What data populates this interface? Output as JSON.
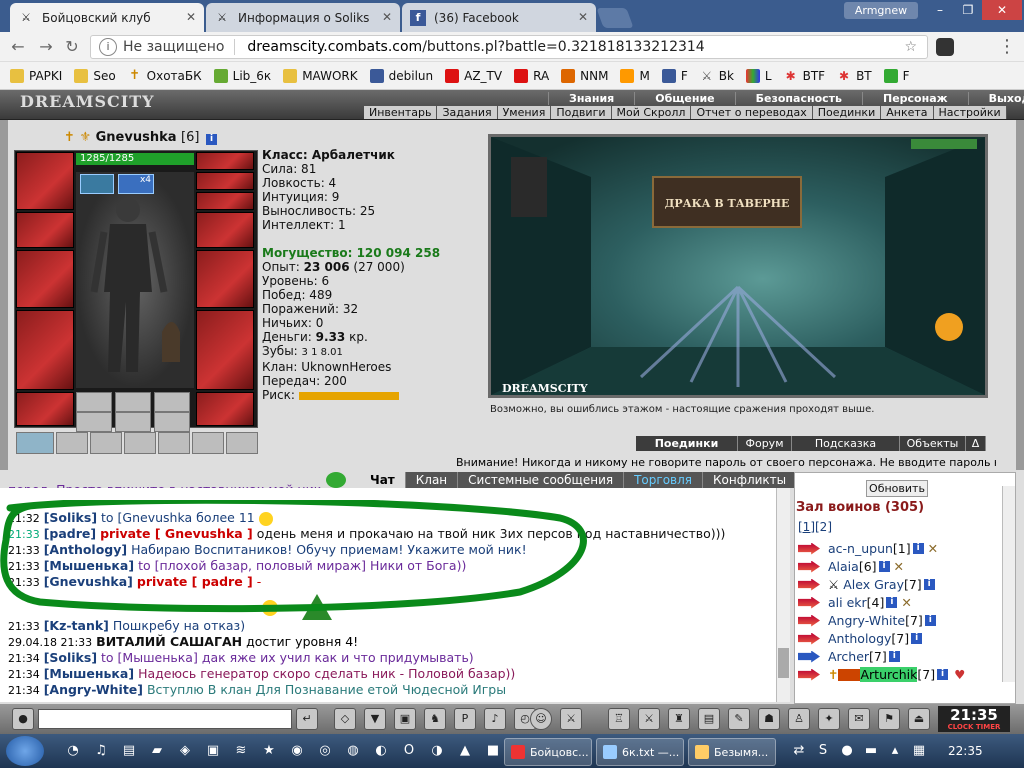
{
  "browser": {
    "tabs": [
      {
        "label": "Бойцовский клуб",
        "active": true
      },
      {
        "label": "Информация о Soliks",
        "active": false
      },
      {
        "label": "(36) Facebook",
        "active": false
      }
    ],
    "user": "Armgnew",
    "address": {
      "security": "Не защищено",
      "domain": "dreamscity.combats.com",
      "path": "/buttons.pl?battle=0.321818133212314"
    },
    "bookmarks": [
      "PAPKI",
      "Seo",
      "ОхотаБК",
      "Lib_6к",
      "MAWORK",
      "debilun",
      "AZ_TV",
      "RA",
      "NNM",
      "M",
      "F",
      "Bk",
      "L",
      "BTF",
      "BT",
      "F"
    ]
  },
  "game": {
    "logo": "DREAMSCITY",
    "top_menu": [
      "Знания",
      "Общение",
      "Безопасность",
      "Персонаж",
      "Выход"
    ],
    "sub_menu": [
      "Инвентарь",
      "Задания",
      "Умения",
      "Подвиги",
      "Мой Скролл",
      "Отчет о переводах",
      "Поединки",
      "Анкета",
      "Настройки"
    ],
    "character": {
      "name": "Gnevushka",
      "level_tag": "[6]",
      "hp": "1285/1285",
      "class": "Класс: Арбалетчик",
      "stats": [
        "Сила: 81",
        "Ловкость: 4",
        "Интуиция: 9",
        "Выносливость: 25",
        "Интеллект: 1"
      ],
      "power_label": "Могущество:",
      "power_value": "120 094 258",
      "exp_label": "Опыт:",
      "exp_value": "23 006",
      "exp_next": "(27 000)",
      "level": "Уровень: 6",
      "wins": "Побед: 489",
      "losses": "Поражений: 32",
      "draws": "Ничьих: 0",
      "money_label": "Деньги:",
      "money_value": "9.33",
      "money_unit": "кр.",
      "teeth": "Зубы:",
      "teeth_values": "3  1  8.01",
      "clan": "Клан: UknownHeroes",
      "transfers": "Передач: 200",
      "risk": "Риск:"
    },
    "scene": {
      "banner": "ДРАКА В ТАВЕРНЕ",
      "logo": "DREAMSCITY",
      "floor_msg": "Возможно, вы ошиблись этажом - настоящие сражения проходят выше."
    },
    "room_buttons": [
      "Поединки",
      "Форум",
      "Подсказка",
      "Объекты",
      "Δ"
    ],
    "warning": "Внимание! Никогда и никому не говорите пароль от своего персонажа. Не вводите пароль на"
  },
  "chat": {
    "tabs": [
      "Чат",
      "Клан",
      "Системные сообщения",
      "Торговля",
      "Конфликты"
    ],
    "top_partial": "перед. Просто впишите в наставниках мой ник",
    "messages": [
      {
        "time": "21:32",
        "nick": "[Soliks]",
        "to": "to [Gnevushka",
        "text": "более 11"
      },
      {
        "time": "21:33",
        "nick": "[padre]",
        "private": "private [ Gnevushka ]",
        "text": "одень меня и прокачаю на твой ник 3их персов под наставничество)))"
      },
      {
        "time": "21:33",
        "nick": "[Anthology]",
        "text": "Набираю Воспитаников! Обучу приемам! Укажите мой ник!"
      },
      {
        "time": "21:33",
        "nick": "[Мышенька]",
        "to": "to [плохой базар, половый мираж]",
        "text": "Ники от Бога))"
      },
      {
        "time": "21:33",
        "nick": "[Gnevushka]",
        "private": "private [ padre ]",
        "text": "-"
      },
      {
        "time": "21:33",
        "nick": "[Kz-tank]",
        "text": "Пошкребу на отказ)"
      },
      {
        "time": "29.04.18 21:33",
        "nick": "ВИТАЛИЙ САШАГАН",
        "text": "достиг уровня 4!"
      },
      {
        "time": "21:34",
        "nick": "[Soliks]",
        "to": "to [Мышенька]",
        "text": "дак яже их учил как и что придумывать)"
      },
      {
        "time": "21:34",
        "nick": "[Мышенька]",
        "text": "Надеюсь генератор скоро сделать ник - Половой базар))"
      },
      {
        "time": "21:34",
        "nick": "[Angry-White]",
        "text": "Вступлю В клан Для Познавание етой Чюдесной Игры"
      }
    ]
  },
  "hall": {
    "refresh": "Обновить",
    "title": "Зал воинов (305)",
    "pages": [
      "[1]",
      "[2]"
    ],
    "players": [
      {
        "name": "ac-n_upun",
        "level": "[1]"
      },
      {
        "name": "Alaia",
        "level": "[6]"
      },
      {
        "name": "Alex Gray",
        "level": "[7]"
      },
      {
        "name": "ali ekr",
        "level": "[4]"
      },
      {
        "name": "Angry-White",
        "level": "[7]"
      },
      {
        "name": "Anthology",
        "level": "[7]"
      },
      {
        "name": "Archer",
        "level": "[7]"
      },
      {
        "name": "Arturchik",
        "level": "[7]"
      }
    ]
  },
  "game_clock": {
    "time": "21:35",
    "left": "CLOCK",
    "right": "TIMER"
  },
  "taskbar": {
    "tasks": [
      "Бойцовс...",
      "6к.txt —...",
      "Безымя..."
    ],
    "time": "22:35"
  },
  "colors": {
    "accent_green": "#1a7a1a",
    "private_red": "#cc0000",
    "nick_blue": "#1a3f7a",
    "circle_green": "#0a8a1a"
  }
}
